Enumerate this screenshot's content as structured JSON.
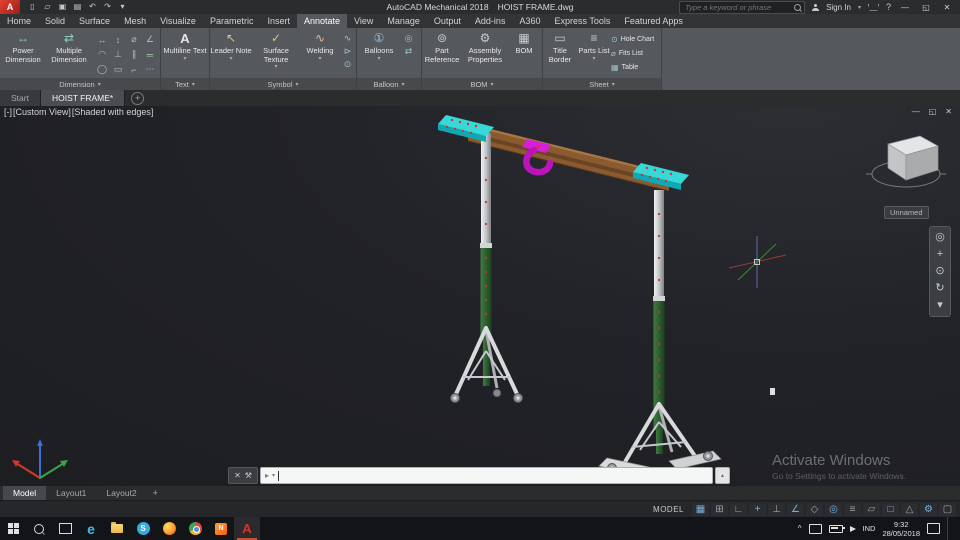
{
  "icons": {
    "caret_down": "▾",
    "caret_up": "▴",
    "close": "✕",
    "minimize": "—",
    "maximize": "▢",
    "restore": "◱",
    "question": "?",
    "wrench": "⚒",
    "prompt_arrow": "▸",
    "plus": "+",
    "expand_caret": "^"
  },
  "titlebar": {
    "logo_letter": "A",
    "app_title": "AutoCAD Mechanical 2018",
    "doc_title": "HOIST FRAME.dwg",
    "search_placeholder": "Type a keyword or phrase",
    "signin_label": "Sign In",
    "qat": [
      {
        "name": "qat-new-button",
        "glyph": "▯"
      },
      {
        "name": "qat-open-button",
        "glyph": "▱"
      },
      {
        "name": "qat-save-button",
        "glyph": "▣"
      },
      {
        "name": "qat-plot-button",
        "glyph": "▤"
      },
      {
        "name": "qat-undo-button",
        "glyph": "↶"
      },
      {
        "name": "qat-redo-button",
        "glyph": "↷"
      },
      {
        "name": "qat-customize-button",
        "glyph": "▾"
      }
    ]
  },
  "ribbon_tabs": [
    {
      "name": "ribbon-tab-home",
      "label": "Home"
    },
    {
      "name": "ribbon-tab-solid",
      "label": "Solid"
    },
    {
      "name": "ribbon-tab-surface",
      "label": "Surface"
    },
    {
      "name": "ribbon-tab-mesh",
      "label": "Mesh"
    },
    {
      "name": "ribbon-tab-visualize",
      "label": "Visualize"
    },
    {
      "name": "ribbon-tab-parametric",
      "label": "Parametric"
    },
    {
      "name": "ribbon-tab-insert",
      "label": "Insert"
    },
    {
      "name": "ribbon-tab-annotate",
      "label": "Annotate",
      "active": true
    },
    {
      "name": "ribbon-tab-view",
      "label": "View"
    },
    {
      "name": "ribbon-tab-manage",
      "label": "Manage"
    },
    {
      "name": "ribbon-tab-output",
      "label": "Output"
    },
    {
      "name": "ribbon-tab-addins",
      "label": "Add-ins"
    },
    {
      "name": "ribbon-tab-a360",
      "label": "A360"
    },
    {
      "name": "ribbon-tab-express-tools",
      "label": "Express Tools"
    },
    {
      "name": "ribbon-tab-featured-apps",
      "label": "Featured Apps"
    }
  ],
  "ribbon": {
    "dimension": {
      "label": "Dimension",
      "power": {
        "label": "Power Dimension",
        "glyph": "↔"
      },
      "multiple": {
        "label": "Multiple Dimension",
        "glyph": "⇄"
      },
      "tools": [
        {
          "name": "dim-linear-icon",
          "glyph": "↔"
        },
        {
          "name": "dim-vertical-icon",
          "glyph": "↕"
        },
        {
          "name": "dim-diameter-icon",
          "glyph": "⌀"
        },
        {
          "name": "dim-angular-icon",
          "glyph": "∠"
        },
        {
          "name": "dim-arc-icon",
          "glyph": "◠"
        },
        {
          "name": "dim-perpendicular-icon",
          "glyph": "⊥"
        },
        {
          "name": "dim-parallel-icon",
          "glyph": "∥"
        },
        {
          "name": "dim-baseline-icon",
          "glyph": "═"
        },
        {
          "name": "dim-center-icon",
          "glyph": "◯"
        },
        {
          "name": "dim-tolerance-icon",
          "glyph": "▭"
        },
        {
          "name": "dim-chamfer-icon",
          "glyph": "⌐"
        },
        {
          "name": "dim-more-icon",
          "glyph": "⋯"
        }
      ]
    },
    "text": {
      "label": "Text",
      "multiline": {
        "label": "Multiline Text",
        "glyph": "A"
      }
    },
    "symbol": {
      "label": "Symbol",
      "leader": {
        "label": "Leader Note",
        "glyph": "↖"
      },
      "surface": {
        "label": "Surface Texture",
        "glyph": "✓"
      },
      "welding": {
        "label": "Welding",
        "glyph": "∿"
      },
      "small": [
        {
          "name": "weld-symbol-icon",
          "glyph": "∿"
        },
        {
          "name": "feature-frame-icon",
          "glyph": "⊳"
        },
        {
          "name": "datum-id-icon",
          "glyph": "⊙"
        }
      ]
    },
    "balloon": {
      "label": "Balloon",
      "balloons": {
        "label": "Balloons",
        "glyph": "①"
      },
      "small": [
        {
          "name": "renumber-balloons-icon",
          "glyph": "◎"
        },
        {
          "name": "align-balloons-icon",
          "glyph": "⇄"
        }
      ]
    },
    "bom": {
      "label": "BOM",
      "part_reference": {
        "label": "Part Reference",
        "glyph": "⊚"
      },
      "assembly_properties": {
        "label": "Assembly Properties",
        "glyph": "⚙"
      },
      "bom_button": {
        "label": "BOM",
        "glyph": "▦"
      }
    },
    "sheet": {
      "label": "Sheet",
      "title_border": {
        "label": "Title Border",
        "glyph": "▭"
      },
      "parts_list": {
        "label": "Parts List",
        "glyph": "≡"
      },
      "rows": [
        {
          "name": "hole-chart-button",
          "glyph": "⊙",
          "label": "Hole Chart"
        },
        {
          "name": "fits-list-button",
          "glyph": "⌀",
          "label": "Fits List"
        },
        {
          "name": "table-button",
          "glyph": "▦",
          "label": "Table"
        }
      ]
    }
  },
  "file_tabs": {
    "start": "Start",
    "doc": "HOIST FRAME*"
  },
  "viewport": {
    "controls": "[-]",
    "view_name": "[Custom View]",
    "visual_style": "[Shaded with edges]",
    "viewcube_label": "Unnamed",
    "navbar": [
      {
        "name": "steering-wheel-icon",
        "glyph": "◎"
      },
      {
        "name": "pan-icon",
        "glyph": "+"
      },
      {
        "name": "zoom-icon",
        "glyph": "⊙"
      },
      {
        "name": "orbit-icon",
        "glyph": "↻"
      },
      {
        "name": "navbar-more-icon",
        "glyph": "▾"
      }
    ],
    "watermark_line1": "Activate Windows",
    "watermark_line2": "Go to Settings to activate Windows."
  },
  "layout_tabs": {
    "model": "Model",
    "layout1": "Layout1",
    "layout2": "Layout2",
    "add": "+"
  },
  "statusbar": {
    "model_label": "MODEL",
    "icons": [
      {
        "name": "status-grid-toggle",
        "glyph": "▦",
        "color": "#7ab1dd"
      },
      {
        "name": "status-snap-toggle",
        "glyph": "⊞",
        "color": "#9ea2a4"
      },
      {
        "name": "status-infer-constraints-toggle",
        "glyph": "∟",
        "color": "#9ea2a4"
      },
      {
        "name": "status-dynamic-input-toggle",
        "glyph": "+",
        "color": "#7ab1dd"
      },
      {
        "name": "status-ortho-toggle",
        "glyph": "⊥",
        "color": "#9ea2a4"
      },
      {
        "name": "status-polar-tracking-toggle",
        "glyph": "∠",
        "color": "#7ab1dd"
      },
      {
        "name": "status-isodraft-toggle",
        "glyph": "◇",
        "color": "#9ea2a4"
      },
      {
        "name": "status-osnap-toggle",
        "glyph": "◎",
        "color": "#7ab1dd"
      },
      {
        "name": "status-lineweight-toggle",
        "glyph": "≡",
        "color": "#9ea2a4"
      },
      {
        "name": "status-transparency-toggle",
        "glyph": "▱",
        "color": "#9ea2a4"
      },
      {
        "name": "status-selection-cycling-toggle",
        "glyph": "□",
        "color": "#7ab1dd"
      },
      {
        "name": "status-annotation-scale-toggle",
        "glyph": "△",
        "color": "#9ea2a4"
      },
      {
        "name": "status-workspace-switch",
        "glyph": "⚙",
        "color": "#7ab1dd"
      },
      {
        "name": "status-clean-screen-toggle",
        "glyph": "▢",
        "color": "#9ea2a4"
      }
    ]
  },
  "taskbar": {
    "edge_glyph": "e",
    "skype_glyph": "S",
    "nitro_glyph": "N",
    "autocad_glyph": "A",
    "lang": "IND",
    "time": "9:32",
    "date": "28/05/2018"
  }
}
